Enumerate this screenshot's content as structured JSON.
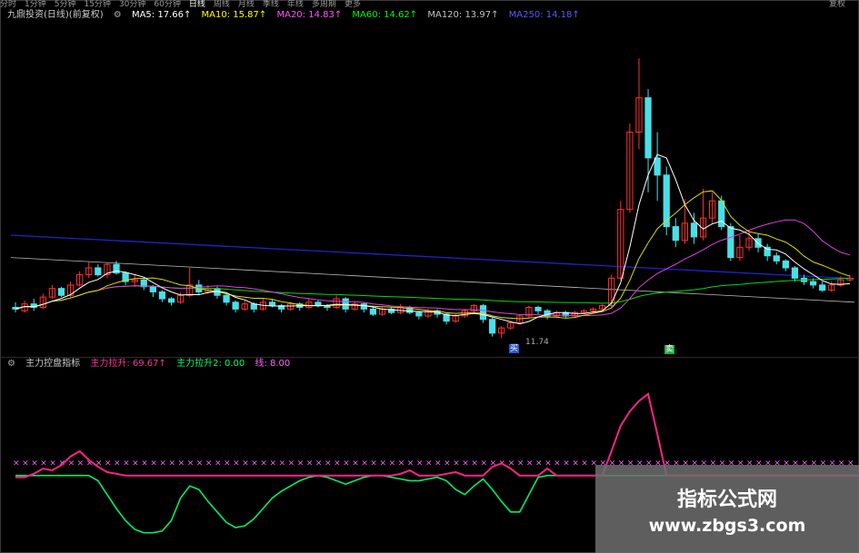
{
  "toolbar": {
    "items": [
      "分时",
      "1分钟",
      "5分钟",
      "15分钟",
      "30分钟",
      "60分钟",
      "日线",
      "周线",
      "月线",
      "季线",
      "年线",
      "多周期",
      "更多"
    ],
    "active_index": 6,
    "right_tabs": [
      "复权"
    ]
  },
  "main_legend": {
    "title": "九鼎投资(日线)(前复权)",
    "ma5": "MA5: 17.66↑",
    "ma10": "MA10: 15.87↑",
    "ma20": "MA20: 14.83↑",
    "ma60": "MA60: 14.62↑",
    "ma120": "MA120: 13.97↑",
    "ma250": "MA250: 14.18↑",
    "colors": {
      "ma5": "#ffffff",
      "ma10": "#ffff00",
      "ma20": "#ff55ff",
      "ma60": "#00ff00",
      "ma120": "#c0c0c0",
      "ma250": "#3030ff"
    }
  },
  "annotations": {
    "low_label": "11.74",
    "flag_low": "买",
    "flag_high": "卖"
  },
  "sub_legend": {
    "title": "主力控盘指标",
    "line1": "主力拉升: 69.67↑",
    "line2": "主力拉升2: 0.00",
    "line3": "线: 8.00",
    "colors": {
      "line1": "#ff3399",
      "line2": "#00ff66",
      "line3": "#ff66ff"
    }
  },
  "watermark": {
    "title": "指标公式网",
    "url": "www.zbgs3.com"
  },
  "chart_data": {
    "type": "candlestick",
    "candles": [
      [
        12.3,
        12.2,
        12.6,
        12.0
      ],
      [
        12.1,
        12.5,
        12.7,
        12.0
      ],
      [
        12.5,
        12.3,
        12.8,
        12.1
      ],
      [
        12.3,
        12.9,
        13.1,
        12.2
      ],
      [
        12.9,
        13.4,
        13.6,
        12.8
      ],
      [
        13.4,
        13.0,
        13.5,
        12.9
      ],
      [
        13.0,
        13.6,
        13.8,
        12.9
      ],
      [
        13.6,
        14.2,
        14.4,
        13.5
      ],
      [
        14.2,
        14.6,
        15.0,
        14.0
      ],
      [
        14.6,
        14.2,
        14.8,
        14.1
      ],
      [
        14.2,
        14.8,
        14.9,
        14.0
      ],
      [
        14.8,
        14.3,
        15.0,
        14.2
      ],
      [
        14.3,
        13.8,
        14.4,
        13.6
      ],
      [
        13.8,
        13.9,
        14.2,
        13.5
      ],
      [
        13.9,
        13.5,
        14.0,
        13.3
      ],
      [
        13.5,
        13.2,
        13.6,
        12.9
      ],
      [
        13.2,
        12.8,
        13.3,
        12.6
      ],
      [
        12.8,
        12.6,
        12.9,
        12.4
      ],
      [
        12.6,
        13.0,
        13.2,
        12.5
      ],
      [
        13.0,
        13.6,
        14.6,
        12.9
      ],
      [
        13.6,
        13.2,
        13.9,
        13.0
      ],
      [
        13.2,
        13.4,
        13.6,
        13.1
      ],
      [
        13.4,
        13.0,
        13.5,
        12.8
      ],
      [
        13.0,
        12.6,
        13.1,
        12.4
      ],
      [
        12.6,
        12.2,
        12.7,
        12.0
      ],
      [
        12.2,
        12.5,
        12.7,
        12.1
      ],
      [
        12.5,
        12.2,
        12.6,
        12.0
      ],
      [
        12.2,
        12.6,
        12.8,
        12.1
      ],
      [
        12.6,
        12.4,
        12.8,
        12.3
      ],
      [
        12.4,
        12.2,
        12.5,
        12.0
      ],
      [
        12.2,
        12.5,
        12.6,
        12.1
      ],
      [
        12.5,
        12.3,
        12.6,
        12.1
      ],
      [
        12.3,
        12.6,
        12.8,
        12.2
      ],
      [
        12.6,
        12.4,
        12.7,
        12.3
      ],
      [
        12.4,
        12.3,
        12.5,
        12.1
      ],
      [
        12.3,
        12.8,
        13.0,
        12.2
      ],
      [
        12.8,
        12.2,
        12.9,
        12.0
      ],
      [
        12.2,
        12.5,
        12.6,
        12.1
      ],
      [
        12.5,
        12.2,
        12.6,
        12.0
      ],
      [
        12.2,
        11.9,
        12.3,
        11.8
      ],
      [
        11.9,
        12.2,
        12.3,
        11.8
      ],
      [
        12.2,
        12.0,
        12.3,
        11.9
      ],
      [
        12.0,
        12.3,
        12.5,
        11.9
      ],
      [
        12.3,
        12.0,
        12.4,
        11.9
      ],
      [
        12.0,
        11.8,
        12.1,
        11.6
      ],
      [
        11.8,
        12.1,
        12.2,
        11.7
      ],
      [
        12.1,
        11.9,
        12.2,
        11.7
      ],
      [
        11.9,
        11.5,
        12.0,
        11.3
      ],
      [
        11.5,
        11.8,
        11.9,
        11.4
      ],
      [
        11.8,
        12.1,
        12.2,
        11.7
      ],
      [
        12.1,
        12.4,
        12.5,
        12.0
      ],
      [
        12.4,
        11.6,
        12.5,
        11.4
      ],
      [
        11.6,
        10.8,
        11.7,
        10.6
      ],
      [
        10.8,
        11.1,
        11.2,
        10.5
      ],
      [
        11.1,
        11.4,
        11.5,
        11.0
      ],
      [
        11.4,
        11.8,
        11.9,
        11.3
      ],
      [
        11.8,
        12.3,
        12.4,
        11.7
      ],
      [
        12.3,
        12.1,
        12.4,
        11.9
      ],
      [
        12.1,
        11.8,
        12.2,
        11.6
      ],
      [
        11.8,
        12.0,
        12.1,
        11.7
      ],
      [
        12.0,
        11.8,
        12.1,
        11.7
      ],
      [
        11.8,
        12.0,
        12.1,
        11.7
      ],
      [
        12.0,
        12.1,
        12.2,
        11.9
      ],
      [
        12.1,
        12.2,
        12.3,
        12.0
      ],
      [
        12.2,
        12.4,
        12.5,
        12.1
      ],
      [
        12.4,
        14.0,
        14.2,
        12.3
      ],
      [
        14.0,
        18.0,
        18.5,
        13.9
      ],
      [
        18.0,
        22.5,
        23.0,
        17.8
      ],
      [
        22.5,
        24.5,
        26.8,
        21.5
      ],
      [
        24.5,
        21.0,
        25.0,
        19.0
      ],
      [
        21.0,
        20.0,
        22.5,
        18.5
      ],
      [
        20.0,
        17.0,
        20.5,
        16.5
      ],
      [
        17.0,
        16.2,
        17.5,
        15.8
      ],
      [
        16.2,
        17.2,
        18.6,
        16.0
      ],
      [
        17.2,
        16.4,
        17.8,
        16.0
      ],
      [
        16.4,
        17.5,
        19.2,
        16.2
      ],
      [
        17.5,
        18.5,
        19.0,
        17.2
      ],
      [
        18.5,
        17.0,
        18.8,
        16.8
      ],
      [
        17.0,
        15.2,
        17.2,
        15.0
      ],
      [
        15.2,
        15.8,
        16.5,
        15.0
      ],
      [
        15.8,
        16.3,
        16.8,
        15.6
      ],
      [
        16.3,
        15.8,
        16.6,
        15.5
      ],
      [
        15.8,
        15.3,
        16.0,
        15.0
      ],
      [
        15.3,
        15.0,
        15.5,
        14.8
      ],
      [
        15.0,
        14.6,
        15.1,
        14.4
      ],
      [
        14.6,
        14.0,
        14.7,
        13.8
      ],
      [
        14.0,
        13.8,
        14.2,
        13.6
      ],
      [
        13.8,
        13.6,
        14.0,
        13.4
      ],
      [
        13.6,
        13.3,
        13.8,
        13.2
      ],
      [
        13.3,
        13.6,
        13.8,
        13.2
      ],
      [
        13.6,
        13.9,
        14.1,
        13.5
      ],
      [
        13.9,
        14.0,
        14.2,
        13.8
      ]
    ],
    "ma120_start": 16.5,
    "ma120_end": 13.97,
    "sub": {
      "line1": [
        40,
        40,
        42,
        45,
        44,
        47,
        52,
        55,
        50,
        46,
        43,
        42,
        41,
        41,
        41,
        41,
        41,
        41,
        41,
        41,
        41,
        41,
        41,
        41,
        41,
        41,
        41,
        41,
        41,
        41,
        41,
        41,
        41,
        41,
        41,
        41,
        41,
        41,
        41,
        41,
        41,
        41,
        42,
        44,
        41,
        41,
        41,
        42,
        43,
        41,
        41,
        41,
        46,
        48,
        45,
        41,
        41,
        41,
        45,
        41,
        41,
        41,
        41,
        41,
        41,
        55,
        69.67,
        78,
        84,
        88,
        65,
        41,
        41,
        41,
        41,
        41,
        41,
        41,
        41,
        41,
        41,
        41,
        41,
        41,
        41,
        41,
        41,
        41,
        41,
        41,
        41,
        41,
        41
      ],
      "line2": [
        41,
        41,
        41,
        41,
        41,
        41,
        41,
        41,
        41,
        38,
        30,
        22,
        15,
        10,
        8,
        8,
        9,
        15,
        28,
        35,
        33,
        26,
        20,
        14,
        11,
        12,
        16,
        22,
        28,
        32,
        35,
        38,
        40,
        41,
        40,
        38,
        36,
        38,
        40,
        41,
        41,
        40,
        39,
        38,
        38,
        39,
        40,
        38,
        33,
        30,
        35,
        39,
        33,
        26,
        20,
        20,
        30,
        40,
        41,
        41,
        41,
        41,
        41,
        41,
        41,
        41,
        41,
        41,
        41,
        41,
        41,
        41,
        41,
        41,
        41,
        41,
        41,
        41,
        41,
        41,
        41,
        41,
        41,
        41,
        41,
        41,
        41,
        41,
        41,
        41,
        41,
        41,
        41
      ],
      "line3": 49
    }
  }
}
